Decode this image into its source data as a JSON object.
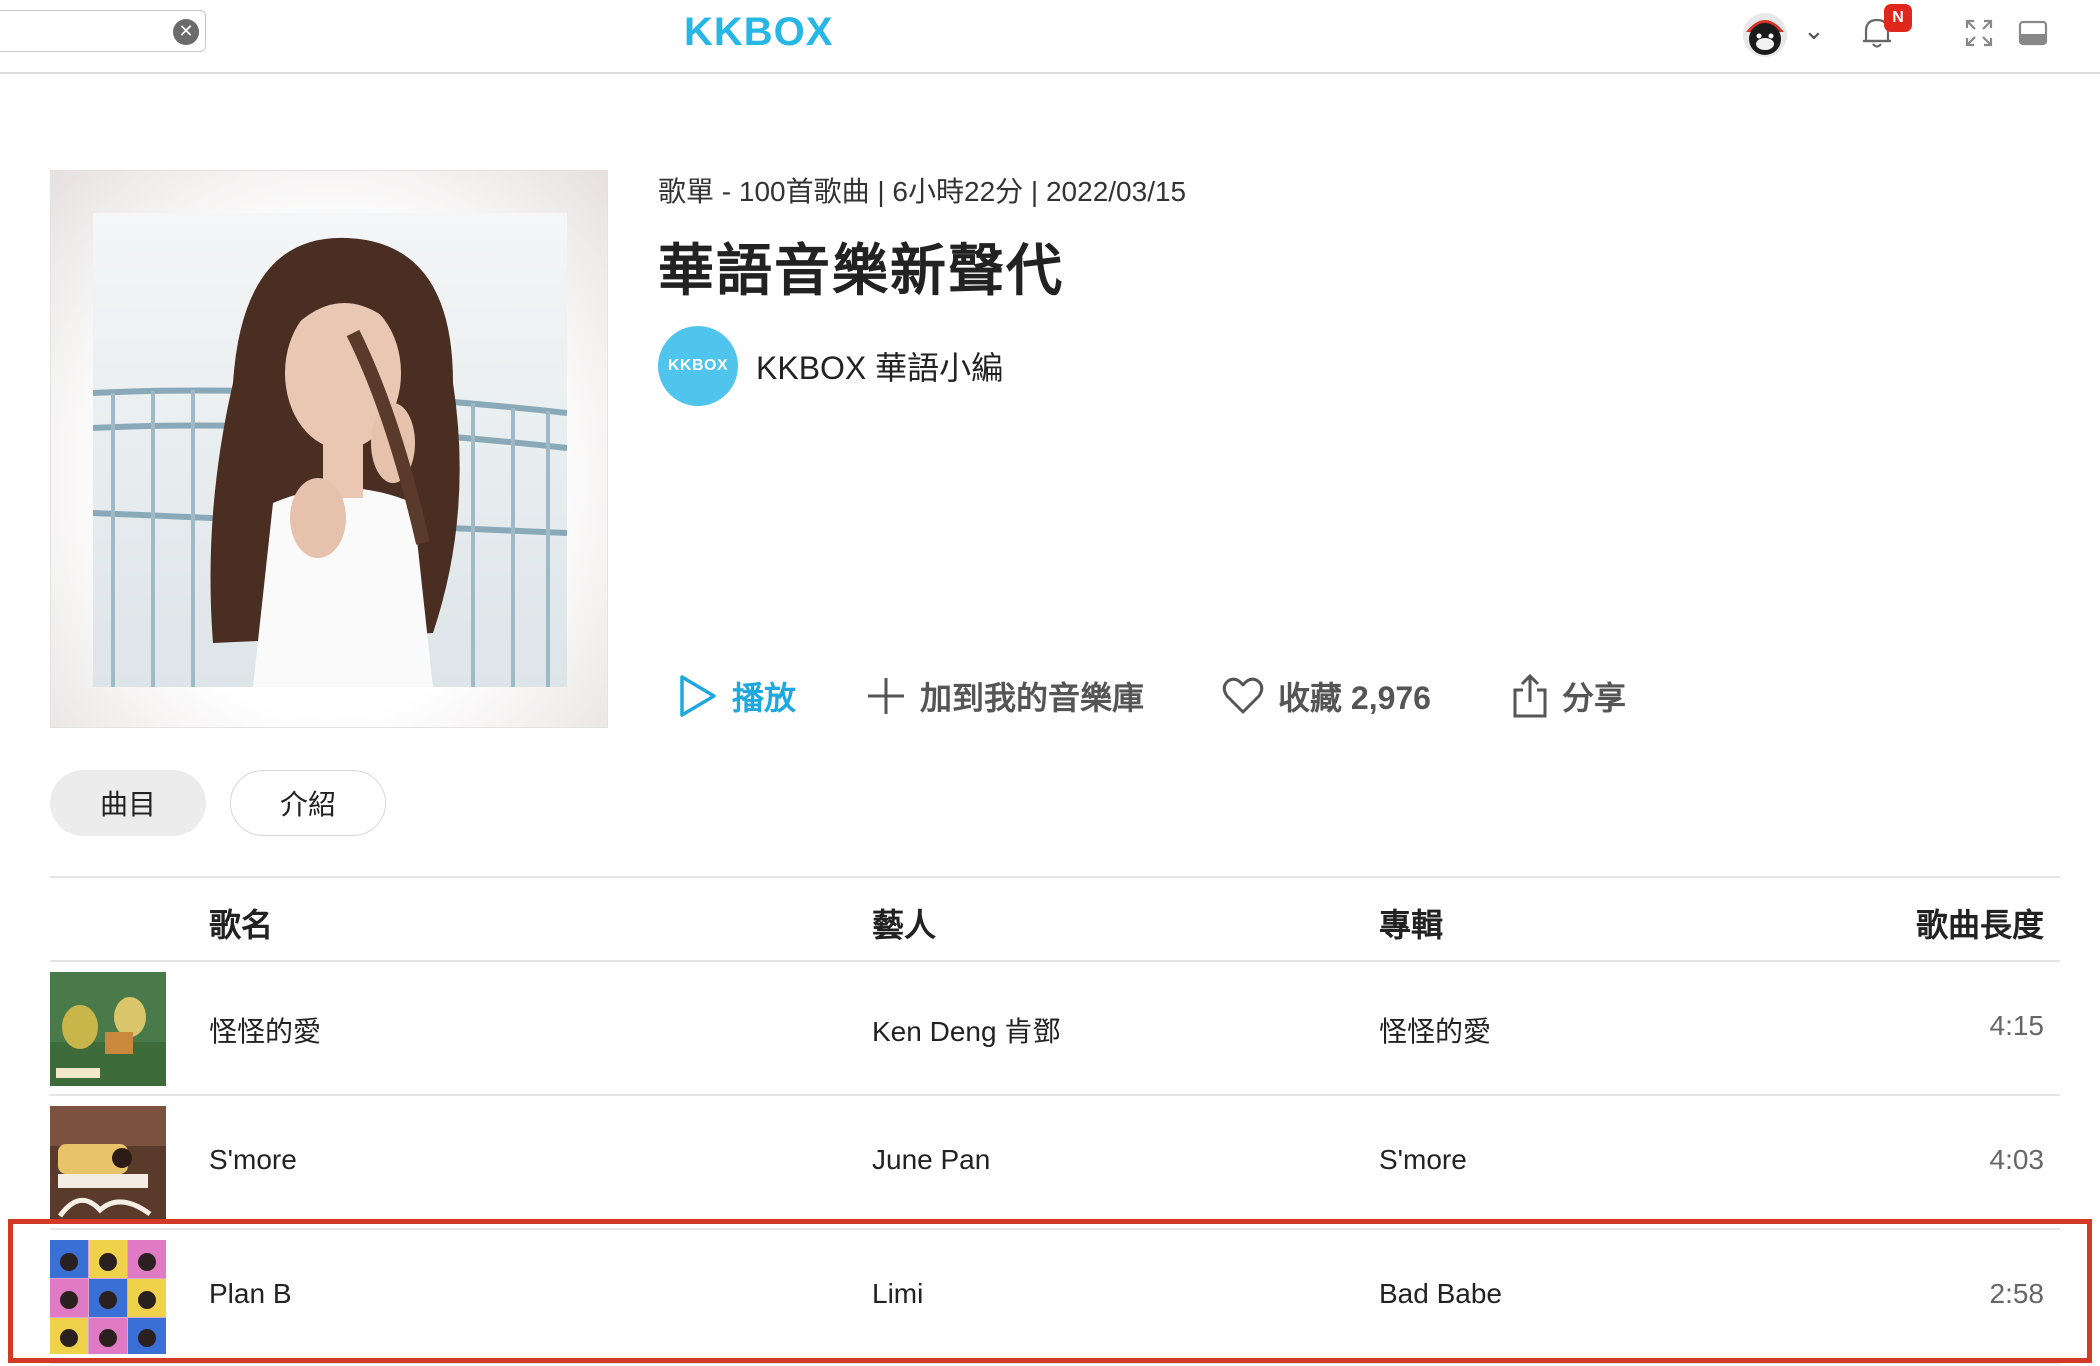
{
  "header": {
    "logo": "KKBOX",
    "notification_badge": "N"
  },
  "playlist": {
    "meta": "歌單 - 100首歌曲 | 6小時22分 | 2022/03/15",
    "title": "華語音樂新聲代",
    "curator_logo": "KKBOX",
    "curator_name": "KKBOX 華語小編"
  },
  "actions": {
    "play": "播放",
    "add": "加到我的音樂庫",
    "favorite": "收藏 2,976",
    "share": "分享"
  },
  "tabs": [
    {
      "label": "曲目",
      "active": true
    },
    {
      "label": "介紹",
      "active": false
    }
  ],
  "table": {
    "headers": {
      "name": "歌名",
      "artist": "藝人",
      "album": "專輯",
      "duration": "歌曲長度"
    },
    "rows": [
      {
        "name": "怪怪的愛",
        "artist": "Ken Deng 肯鄧",
        "album": "怪怪的愛",
        "duration": "4:15"
      },
      {
        "name": "S'more",
        "artist": "June Pan",
        "album": "S'more",
        "duration": "4:03"
      },
      {
        "name": "Plan B",
        "artist": "Limi",
        "album": "Bad Babe",
        "duration": "2:58"
      }
    ]
  },
  "colors": {
    "accent": "#1fa8e0",
    "logo": "#27b7e6",
    "badge": "#e1261c",
    "highlight": "#d33a25"
  }
}
